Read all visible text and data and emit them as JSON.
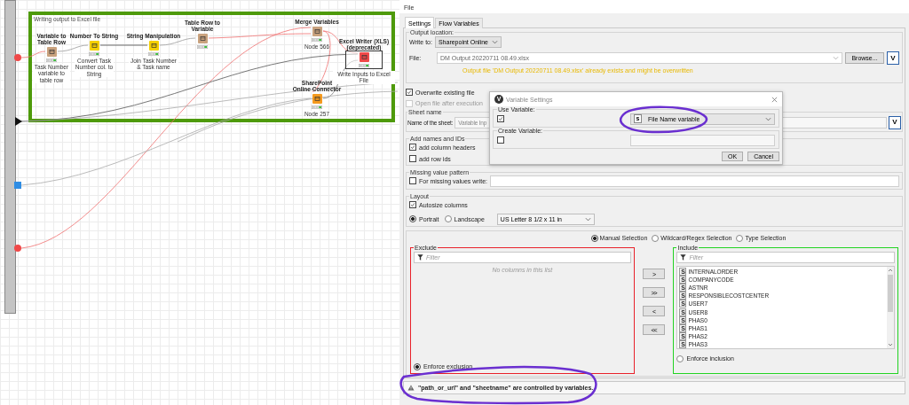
{
  "canvas": {
    "annotation": "Writing output to Excel file",
    "nodes": [
      {
        "title": "Variable to Table Row",
        "label": "Task Number variable to table row",
        "kind": "manipulator",
        "selected": false
      },
      {
        "title": "Number To String",
        "label": "Convert Task Number col. to String",
        "kind": "converter",
        "selected": false
      },
      {
        "title": "String Manipulation",
        "label": "Join Task Number & Task name",
        "kind": "converter",
        "selected": false
      },
      {
        "title": "Table Row to Variable",
        "kind": "manipulator",
        "selected": false
      },
      {
        "title": "Merge Variables",
        "label": "Node 566",
        "kind": "manipulator",
        "selected": false
      },
      {
        "title": "Excel Writer (XLS) (deprecated)",
        "label": "Write Inputs to Excel File",
        "kind": "writer",
        "selected": true
      },
      {
        "title": "SharePoint Online Connector",
        "label": "Node 257",
        "kind": "connector",
        "selected": false
      }
    ]
  },
  "dialog": {
    "title": "File",
    "tabs": [
      {
        "label": "Settings",
        "selected": true
      },
      {
        "label": "Flow Variables",
        "selected": false
      }
    ],
    "output_location": {
      "legend": "Output location:",
      "write_to_label": "Write to:",
      "write_to": "Sharepoint Online",
      "file_label": "File:",
      "file": "DM Output 20220711 08.49.xlsx",
      "browse": "Browse...",
      "variable_button": "V",
      "warning": "Output file 'DM Output 20220711 08.49.xlsx' already exists and might be overwritten"
    },
    "options": [
      {
        "label": "Overwrite existing file",
        "checked": true,
        "disabled": false
      },
      {
        "label": "Open file after execution",
        "checked": false,
        "disabled": true
      }
    ],
    "sheet_name": {
      "legend": "Sheet name",
      "label": "Name of the sheet:",
      "value": "Variable Inp",
      "variable_button": "V"
    },
    "names_ids": {
      "legend": "Add names and IDs",
      "options": [
        {
          "label": "add column headers",
          "checked": true
        },
        {
          "label": "add row ids",
          "checked": false
        }
      ]
    },
    "missing": {
      "legend": "Missing value pattern",
      "label": "For missing values write:",
      "checked": false
    },
    "layout": {
      "legend": "Layout",
      "autosize": {
        "label": "Autosize columns",
        "checked": true
      },
      "orientation": [
        {
          "label": "Portrait",
          "selected": true
        },
        {
          "label": "Landscape",
          "selected": false
        }
      ],
      "paper": "US Letter 8 1/2 x 11 in"
    },
    "selection_modes": [
      {
        "label": "Manual Selection",
        "selected": true
      },
      {
        "label": "Wildcard/Regex Selection",
        "selected": false
      },
      {
        "label": "Type Selection",
        "selected": false
      }
    ],
    "exclude": {
      "legend": "Exclude",
      "placeholder": "Filter",
      "empty": "No columns in this list",
      "enforce": {
        "label": "Enforce exclusion",
        "selected": true
      }
    },
    "move_buttons": [
      ">",
      ">>",
      "<",
      "<<"
    ],
    "include": {
      "legend": "Include",
      "placeholder": "Filter",
      "columns": [
        {
          "type": "S",
          "name": "INTERNALORDER"
        },
        {
          "type": "S",
          "name": "COMPANYCODE"
        },
        {
          "type": "S",
          "name": "ASTNR"
        },
        {
          "type": "S",
          "name": "RESPONSIBLECOSTCENTER"
        },
        {
          "type": "S",
          "name": "USER7"
        },
        {
          "type": "S",
          "name": "USER8"
        },
        {
          "type": "S",
          "name": "PHAS0"
        },
        {
          "type": "S",
          "name": "PHAS1"
        },
        {
          "type": "S",
          "name": "PHAS2"
        },
        {
          "type": "S",
          "name": "PHAS3"
        }
      ],
      "enforce": {
        "label": "Enforce inclusion",
        "selected": false
      }
    },
    "status": "\"path_or_url\" and \"sheetname\" are controlled by variables."
  },
  "variable_settings": {
    "icon": "V",
    "title": "Variable Settings",
    "use_legend": "Use Variable:",
    "use_checked": true,
    "variable_type": "s",
    "variable": "File Name variable",
    "create_legend": "Create Variable:",
    "create_checked": false,
    "buttons": [
      "OK",
      "Cancel"
    ]
  }
}
